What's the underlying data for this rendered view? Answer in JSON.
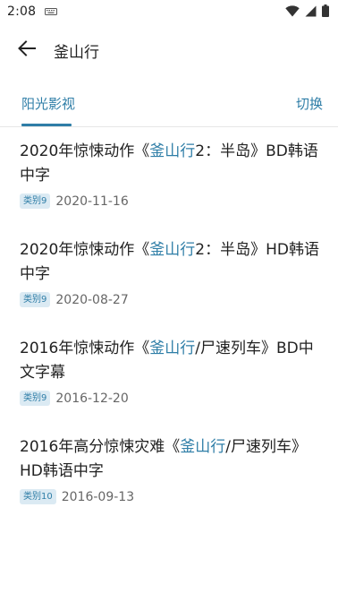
{
  "status_bar": {
    "time": "2:08",
    "icons": [
      "keyboard-icon",
      "wifi-icon",
      "signal-icon",
      "battery-icon"
    ]
  },
  "app_bar": {
    "back_icon": "arrow-left-icon",
    "title": "釜山行"
  },
  "tabs": {
    "active": "阳光影视",
    "switch_label": "切换"
  },
  "accent_color": "#2f7ea7",
  "items": [
    {
      "pre": "2020年惊悚动作《",
      "highlight": "釜山行",
      "post": "2：半岛》BD韩语中字",
      "badge": "类别9",
      "date": "2020-11-16"
    },
    {
      "pre": "2020年惊悚动作《",
      "highlight": "釜山行",
      "post": "2：半岛》HD韩语中字",
      "badge": "类别9",
      "date": "2020-08-27"
    },
    {
      "pre": "2016年惊悚动作《",
      "highlight": "釜山行",
      "post": "/尸速列车》BD中文字幕",
      "badge": "类别9",
      "date": "2016-12-20"
    },
    {
      "pre": "2016年高分惊悚灾难《",
      "highlight": "釜山行",
      "post": "/尸速列车》HD韩语中字",
      "badge": "类别10",
      "date": "2016-09-13"
    }
  ]
}
